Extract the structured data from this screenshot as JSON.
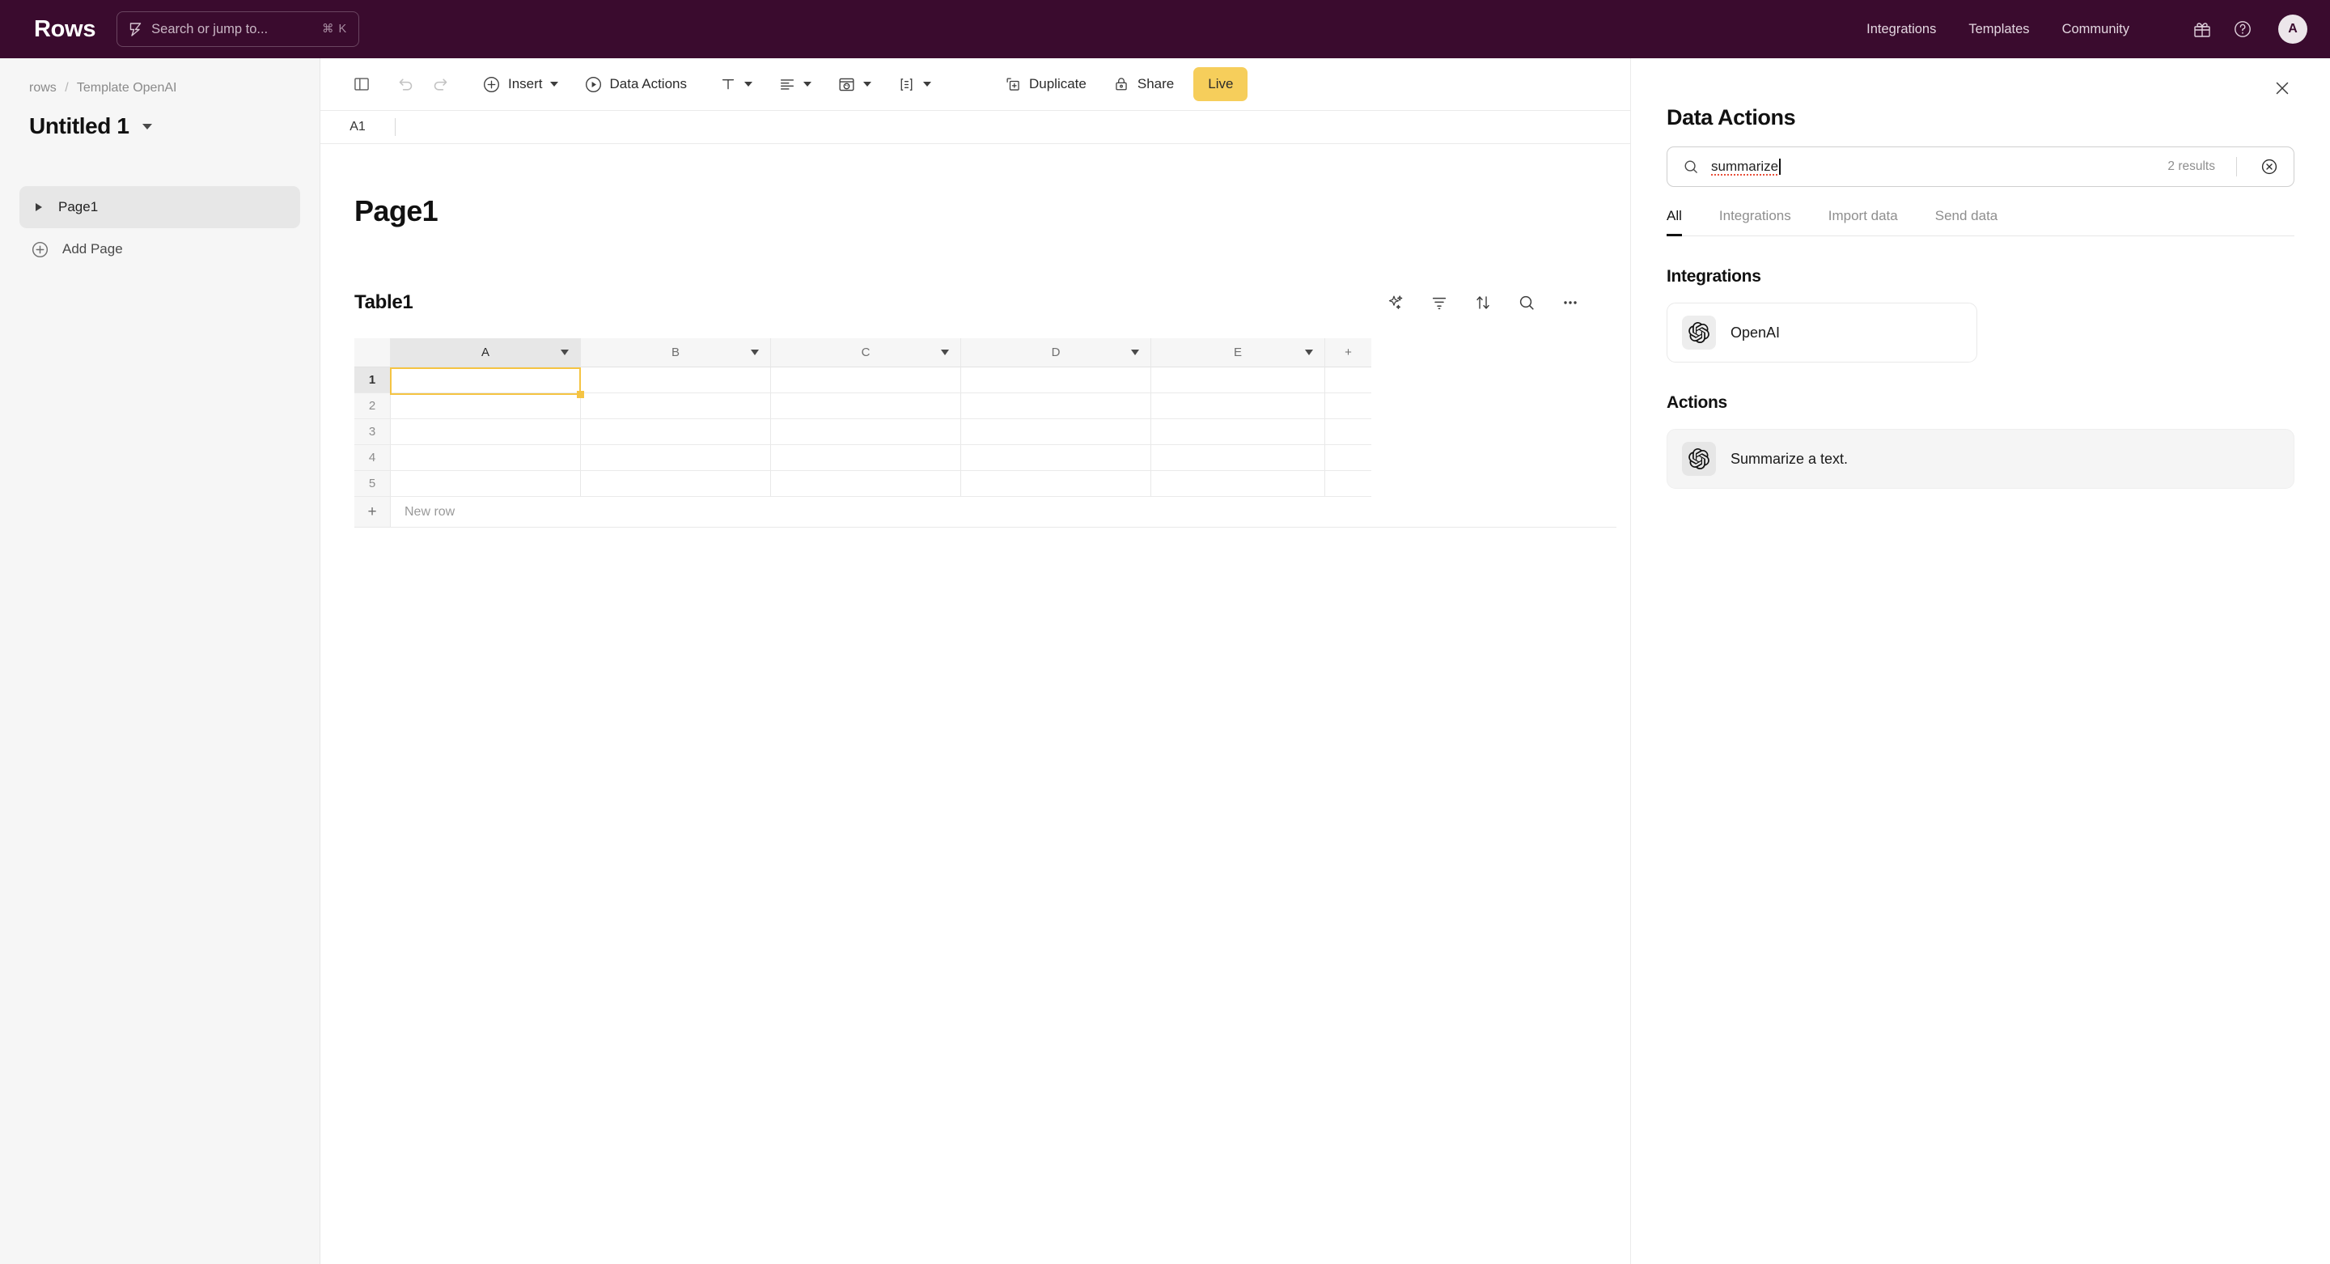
{
  "topbar": {
    "brand": "Rows",
    "search": {
      "placeholder": "Search or jump to...",
      "shortcut": "⌘ K",
      "icon": "lightning-bolt-icon"
    },
    "nav": [
      {
        "label": "Integrations",
        "name": "integrations"
      },
      {
        "label": "Templates",
        "name": "templates"
      },
      {
        "label": "Community",
        "name": "community"
      }
    ],
    "icons": [
      {
        "name": "gift-icon"
      },
      {
        "name": "help-circle-icon"
      }
    ],
    "avatar": {
      "initial": "A"
    },
    "background_color": "#3A0B2E"
  },
  "sidebar": {
    "breadcrumb": {
      "workspace": "rows",
      "separator": "/",
      "folder": "Template OpenAI"
    },
    "doc_title": "Untitled 1",
    "pages": [
      {
        "label": "Page1",
        "active": true
      }
    ],
    "add_page_label": "Add Page"
  },
  "toolbar": {
    "sidebar_toggle": "panel-toggle-icon",
    "undo": "undo-icon",
    "redo": "redo-icon",
    "insert_label": "Insert",
    "data_actions_label": "Data Actions",
    "text_format": "text-format-icon",
    "align": "align-icon",
    "color": "fill-color-icon",
    "borders": "borders-icon",
    "duplicate_label": "Duplicate",
    "share_label": "Share",
    "live_label": "Live",
    "live_color": "#F6CE5B"
  },
  "formula_bar": {
    "cell_ref": "A1",
    "value": ""
  },
  "canvas": {
    "page_heading": "Page1",
    "table": {
      "name": "Table1",
      "tools": [
        {
          "name": "ai-sparkle-icon"
        },
        {
          "name": "filter-icon"
        },
        {
          "name": "sort-icon"
        },
        {
          "name": "search-icon"
        },
        {
          "name": "more-options-icon"
        }
      ],
      "columns": [
        "A",
        "B",
        "C",
        "D",
        "E"
      ],
      "add_column_label": "+",
      "rows": [
        "1",
        "2",
        "3",
        "4",
        "5"
      ],
      "cells": [
        [
          "",
          "",
          "",
          "",
          ""
        ],
        [
          "",
          "",
          "",
          "",
          ""
        ],
        [
          "",
          "",
          "",
          "",
          ""
        ],
        [
          "",
          "",
          "",
          "",
          ""
        ],
        [
          "",
          "",
          "",
          "",
          ""
        ]
      ],
      "selected_cell": "A1",
      "selection_color": "#F5C443",
      "new_row_label": "New row"
    }
  },
  "panel": {
    "title": "Data Actions",
    "close_icon": "close-icon",
    "search": {
      "value": "summarize",
      "results_count": "2 results",
      "clear_icon": "clear-circle-icon",
      "search_icon": "search-icon"
    },
    "tabs": [
      {
        "label": "All",
        "active": true
      },
      {
        "label": "Integrations",
        "active": false
      },
      {
        "label": "Import data",
        "active": false
      },
      {
        "label": "Send data",
        "active": false
      }
    ],
    "sections": [
      {
        "title": "Integrations",
        "cards": [
          {
            "label": "OpenAI",
            "icon": "openai-logo-icon",
            "hover": false,
            "width": "narrow"
          }
        ]
      },
      {
        "title": "Actions",
        "cards": [
          {
            "label": "Summarize a text.",
            "icon": "openai-logo-icon",
            "hover": true,
            "width": "wide"
          }
        ]
      }
    ]
  }
}
